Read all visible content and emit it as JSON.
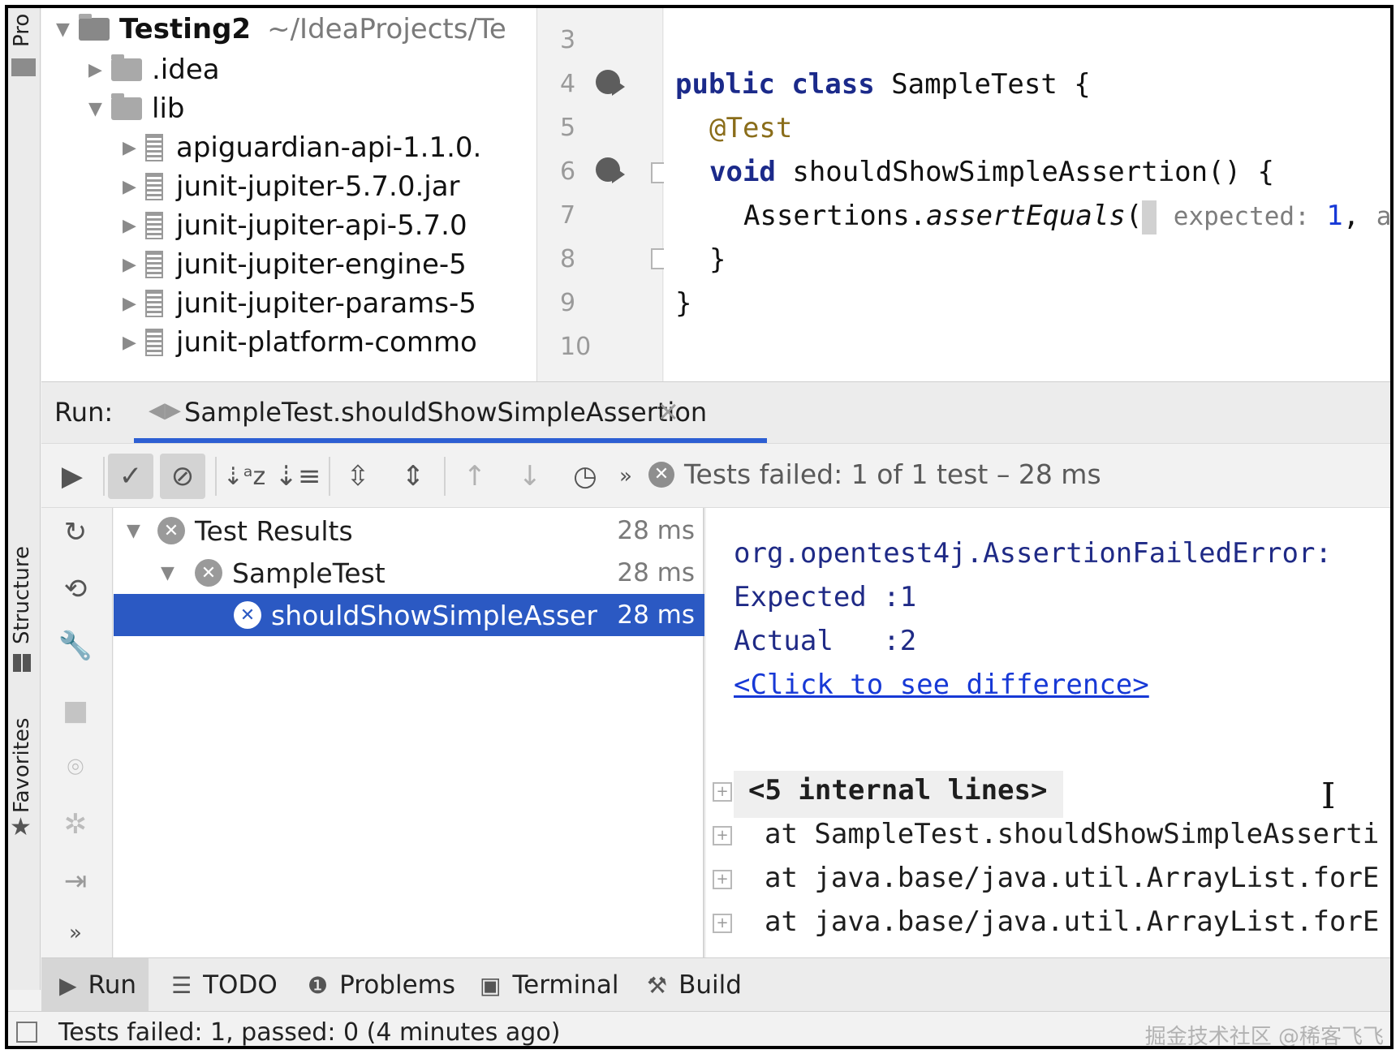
{
  "left_strip": {
    "project_label": "Pro",
    "structure_label": "Structure",
    "favorites_label": "Favorites"
  },
  "project": {
    "root_name": "Testing2",
    "root_path": "~/IdeaProjects/Te",
    "items": [
      {
        "name": ".idea",
        "type": "folder"
      },
      {
        "name": "lib",
        "type": "folder"
      },
      {
        "name": "apiguardian-api-1.1.0.",
        "type": "jar"
      },
      {
        "name": "junit-jupiter-5.7.0.jar",
        "type": "jar"
      },
      {
        "name": "junit-jupiter-api-5.7.0",
        "type": "jar"
      },
      {
        "name": "junit-jupiter-engine-5",
        "type": "jar"
      },
      {
        "name": "junit-jupiter-params-5",
        "type": "jar"
      },
      {
        "name": "junit-platform-commo",
        "type": "jar"
      }
    ]
  },
  "editor": {
    "line_numbers": [
      "3",
      "4",
      "5",
      "6",
      "7",
      "8",
      "9",
      "10"
    ],
    "line4": {
      "kw1": "public",
      "kw2": "class",
      "rest": " SampleTest {"
    },
    "line5": {
      "annotation": "@Test"
    },
    "line6": {
      "kw": "void",
      "rest": " shouldShowSimpleAssertion() {"
    },
    "line7": {
      "receiver": "Assertions.",
      "method": "assertEquals",
      "paren": "(",
      "hint": "expected:",
      "value": "1",
      "comma": ",",
      "hint2": "act"
    },
    "line8": "}",
    "line9": "}"
  },
  "run": {
    "label": "Run:",
    "tab_label": "SampleTest.shouldShowSimpleAssertion",
    "close": "×",
    "status": "Tests failed: 1 of 1 test – 28 ms",
    "more": "»"
  },
  "tests": [
    {
      "name": "Test Results",
      "time": "28 ms"
    },
    {
      "name": "SampleTest",
      "time": "28 ms"
    },
    {
      "name": "shouldShowSimpleAsser",
      "time": "28 ms"
    }
  ],
  "console": {
    "error": "org.opentest4j.AssertionFailedError:",
    "expected": "Expected :1",
    "actual": "Actual   :2",
    "diff_link": "<Click to see difference>",
    "internal": "<5 internal lines>",
    "stack": [
      "at SampleTest.shouldShowSimpleAsserti",
      "at java.base/java.util.ArrayList.forE",
      "at java.base/java.util.ArrayList.forE"
    ]
  },
  "bottom_tabs": {
    "run": "Run",
    "todo": "TODO",
    "problems": "Problems",
    "terminal": "Terminal",
    "build": "Build"
  },
  "status_bar": {
    "text": "Tests failed: 1, passed: 0 (4 minutes ago)",
    "watermark": "掘金技术社区 @稀客飞飞"
  }
}
